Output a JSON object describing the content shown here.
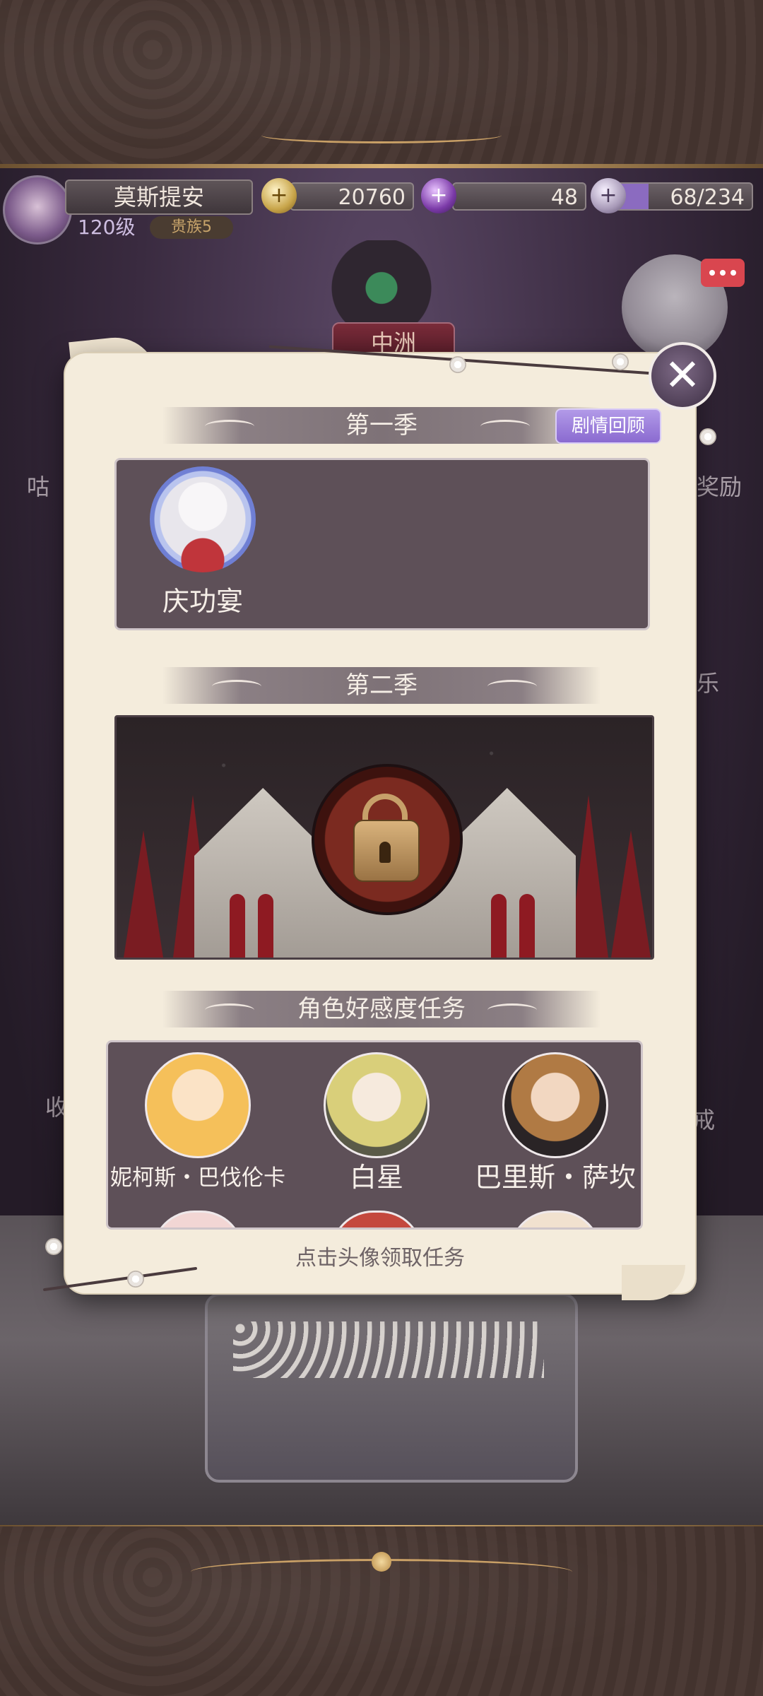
{
  "player": {
    "name": "莫斯提安",
    "level": "120级",
    "rank": "贵族5"
  },
  "resources": {
    "coins": "20760",
    "gems": "48",
    "tickets": "68/234",
    "coin_icon": "coin-icon",
    "gem_icon": "gem-icon",
    "ticket_icon": "ticket-icon"
  },
  "background": {
    "region_label": "中洲",
    "left_partial_text": "咕",
    "right_partial_text": "奖励",
    "right_partial_text_2": "乐",
    "left_partial_text_3": "收",
    "right_partial_text_3": "戒"
  },
  "modal": {
    "season1_title": "第一季",
    "review_button": "剧情回顾",
    "season1_stories": [
      {
        "label": "庆功宴"
      }
    ],
    "season2_title": "第二季",
    "season2_locked": true,
    "affinity_title": "角色好感度任务",
    "characters": [
      {
        "name": "妮柯斯・巴伐伦卡"
      },
      {
        "name": "白星"
      },
      {
        "name": "巴里斯・萨坎"
      }
    ],
    "hint": "点击头像领取任务",
    "close_icon": "close-icon"
  },
  "colors": {
    "panel": "#5e5058",
    "parchment": "#f4ecdc",
    "accent_purple": "#9a7ddb",
    "gold": "#d8b071"
  }
}
